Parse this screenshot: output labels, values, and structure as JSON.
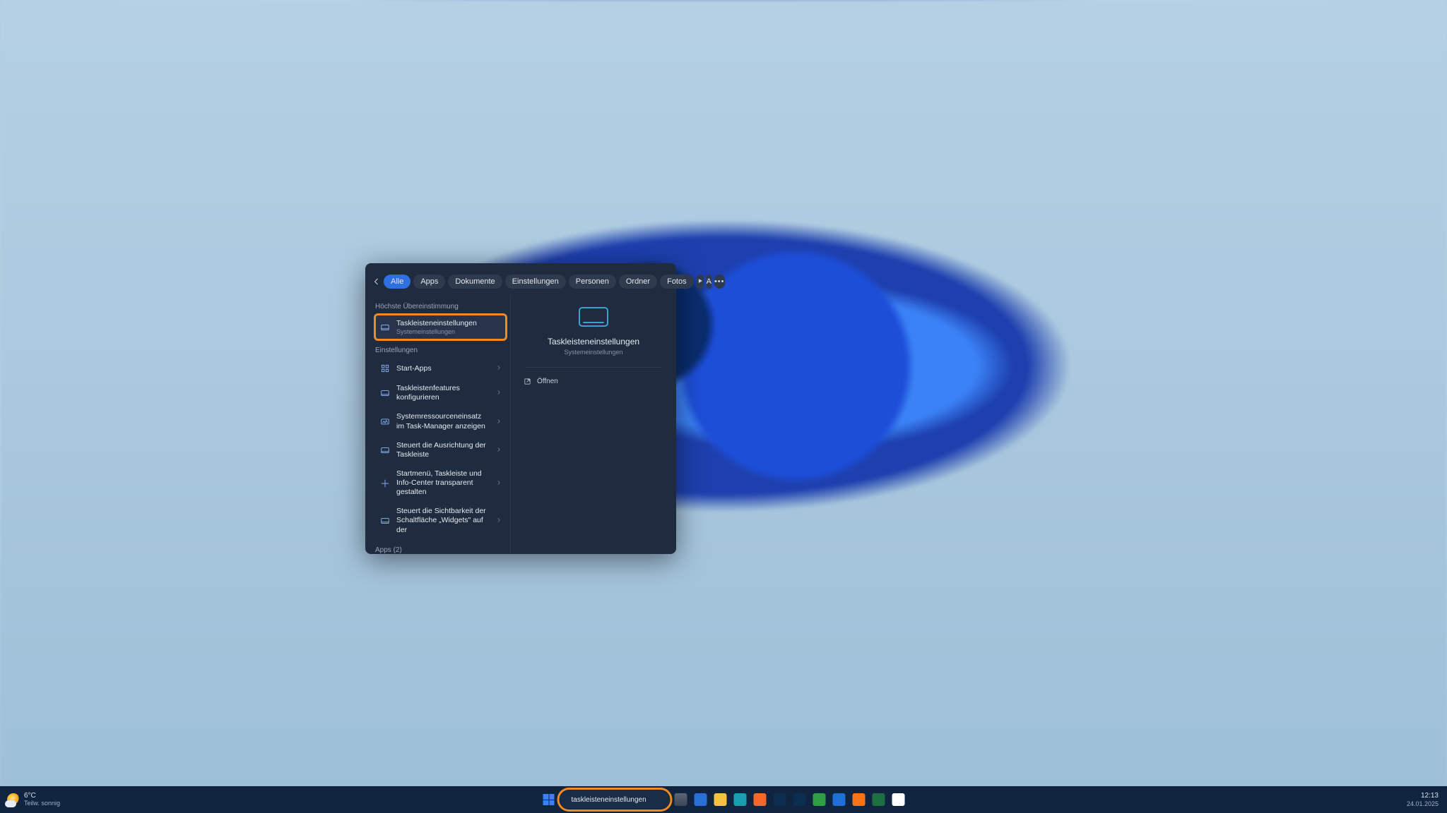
{
  "tabs": {
    "alle": "Alle",
    "apps": "Apps",
    "dokumente": "Dokumente",
    "einstellungen": "Einstellungen",
    "personen": "Personen",
    "ordner": "Ordner",
    "fotos": "Fotos",
    "font_label": "A"
  },
  "left": {
    "section_best": "Höchste Übereinstimmung",
    "best": {
      "title": "Taskleisteneinstellungen",
      "sub": "Systemeinstellungen"
    },
    "section_settings": "Einstellungen",
    "items": [
      {
        "title": "Start-Apps"
      },
      {
        "title": "Taskleistenfeatures konfigurieren"
      },
      {
        "title": "Systemressourceneinsatz im Task-Manager anzeigen"
      },
      {
        "title": "Steuert die Ausrichtung der Taskleiste"
      },
      {
        "title": "Startmenü, Taskleiste und Info-Center transparent gestalten"
      },
      {
        "title": "Steuert die Sichtbarkeit der Schaltfläche „Widgets\" auf der"
      }
    ],
    "apps_hdr": "Apps (2)"
  },
  "right": {
    "title": "Taskleisteneinstellungen",
    "sub": "Systemeinstellungen",
    "open": "Öffnen"
  },
  "taskbar": {
    "weather": {
      "temp": "6°C",
      "desc": "Teilw. sonnig"
    },
    "search_value": "taskleisteneinstellungen",
    "clock": {
      "time": "12:13",
      "date": "24.01.2025"
    }
  },
  "colors": {
    "explorer": "#f4c141",
    "store": "#2a6fd6",
    "teams": "#5059c9",
    "edge": "#1a9eaf",
    "firefox": "#f5682a",
    "ps": "#0b2d4e",
    "lrc": "#0b2d4e",
    "sec": "#2f9e44",
    "mail": "#1e6fd6",
    "ffdev": "#f97316",
    "excel": "#1d6f42",
    "chrome": "#ffffff"
  }
}
